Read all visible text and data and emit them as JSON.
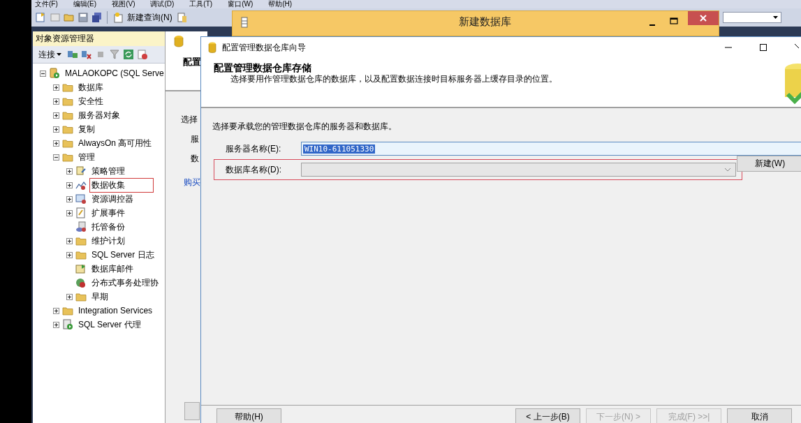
{
  "menu": [
    "文件(F)",
    "编辑(E)",
    "视图(V)",
    "调试(D)",
    "工具(T)",
    "窗口(W)",
    "帮助(H)"
  ],
  "toolbar": {
    "new_query": "新建查询(N)"
  },
  "object_explorer": {
    "title": "对象资源管理器",
    "connect": "连接",
    "tree": [
      {
        "label": "MALAOKOPC (SQL Serve",
        "kind": "server",
        "expander": true,
        "expanded": true,
        "annotated": false,
        "children": [
          {
            "label": "数据库",
            "kind": "folder",
            "expander": true,
            "expanded": false,
            "annotated": false
          },
          {
            "label": "安全性",
            "kind": "folder",
            "expander": true,
            "expanded": false,
            "annotated": false
          },
          {
            "label": "服务器对象",
            "kind": "folder",
            "expander": true,
            "expanded": false,
            "annotated": false
          },
          {
            "label": "复制",
            "kind": "folder",
            "expander": true,
            "expanded": false,
            "annotated": false
          },
          {
            "label": "AlwaysOn 高可用性",
            "kind": "folder",
            "expander": true,
            "expanded": false,
            "annotated": false
          },
          {
            "label": "管理",
            "kind": "folder",
            "expander": true,
            "expanded": true,
            "annotated": false,
            "children": [
              {
                "label": "策略管理",
                "kind": "policy",
                "expander": true,
                "expanded": false,
                "annotated": false
              },
              {
                "label": "数据收集",
                "kind": "chart",
                "expander": true,
                "expanded": false,
                "annotated": true
              },
              {
                "label": "资源调控器",
                "kind": "monitor",
                "expander": true,
                "expanded": false,
                "annotated": false
              },
              {
                "label": "扩展事件",
                "kind": "events",
                "expander": true,
                "expanded": false,
                "annotated": false
              },
              {
                "label": "托管备份",
                "kind": "backup",
                "expander": false,
                "expanded": false,
                "annotated": false
              },
              {
                "label": "维护计划",
                "kind": "folder",
                "expander": true,
                "expanded": false,
                "annotated": false
              },
              {
                "label": "SQL Server 日志",
                "kind": "folder",
                "expander": true,
                "expanded": false,
                "annotated": false
              },
              {
                "label": "数据库邮件",
                "kind": "mail",
                "expander": false,
                "expanded": false,
                "annotated": false
              },
              {
                "label": "分布式事务处理协",
                "kind": "dtc",
                "expander": false,
                "expanded": false,
                "annotated": false
              },
              {
                "label": "早期",
                "kind": "folder",
                "expander": true,
                "expanded": false,
                "annotated": false
              }
            ]
          },
          {
            "label": "Integration Services",
            "kind": "folder",
            "expander": true,
            "expanded": false,
            "annotated": false
          },
          {
            "label": "SQL Server 代理",
            "kind": "agent",
            "expander": true,
            "expanded": false,
            "annotated": false
          }
        ]
      }
    ]
  },
  "back_window": {
    "heading": "配置",
    "texts": [
      "选择",
      "服",
      "数"
    ],
    "link": "购买"
  },
  "new_database_window": {
    "title": "新建数据库"
  },
  "wizard": {
    "title": "配置管理数据仓库向导",
    "heading": "配置管理数据仓库存储",
    "description": "选择要用作管理数据仓库的数据库，以及配置数据连接时目标服务器上缓存目录的位置。",
    "instruction": "选择要承载您的管理数据仓库的服务器和数据库。",
    "fields": [
      {
        "kind": "text",
        "label": "服务器名称(E):",
        "value": "WIN10-611051330",
        "selected": true,
        "disabled": false,
        "annotated": false
      },
      {
        "kind": "combo",
        "label": "数据库名称(D):",
        "disabled": true,
        "annotated": true
      }
    ],
    "new_button": "新建(W)",
    "help_button": {
      "label": "帮助(H)",
      "disabled": false
    },
    "buttons": [
      {
        "label": "< 上一步(B)",
        "disabled": false
      },
      {
        "label": "下一步(N) >",
        "disabled": true
      },
      {
        "label": "完成(F) >>|",
        "disabled": true
      },
      {
        "label": "取消",
        "disabled": false
      }
    ]
  }
}
